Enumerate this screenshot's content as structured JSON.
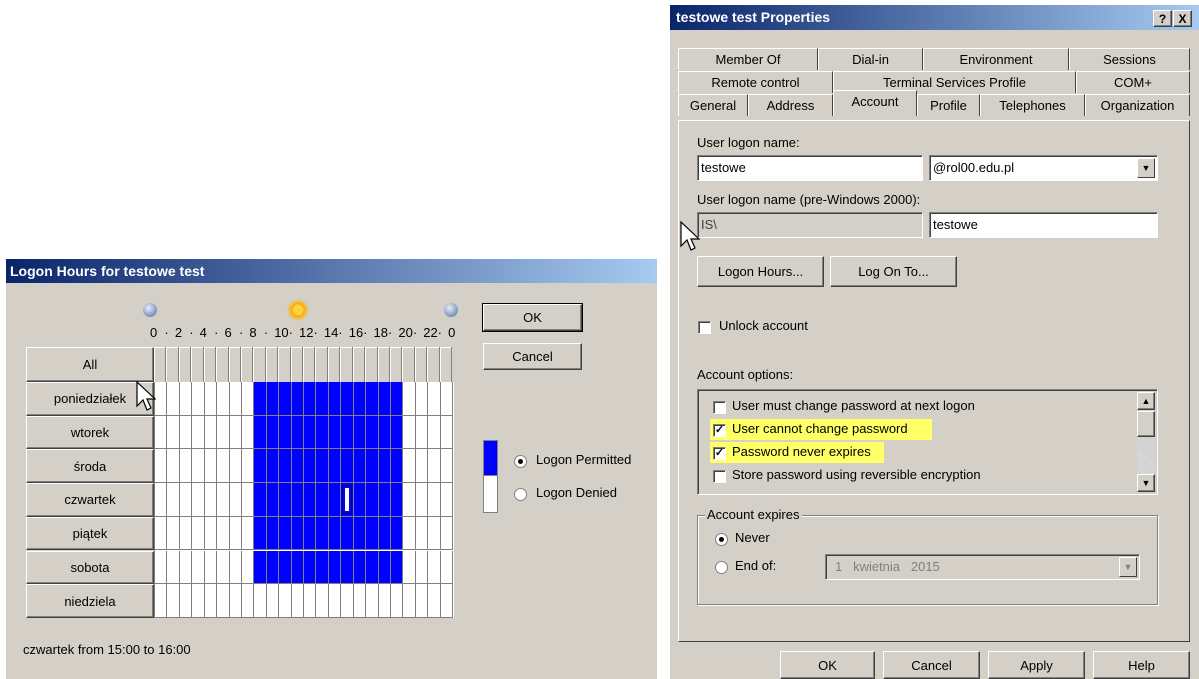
{
  "logon_hours": {
    "title": "Logon Hours for testowe test",
    "hour_labels": [
      "0",
      "2",
      "4",
      "6",
      "8",
      "10",
      "12",
      "14",
      "16",
      "18",
      "20",
      "22",
      "0"
    ],
    "ok_label": "OK",
    "cancel_label": "Cancel",
    "all_label": "All",
    "days": [
      "poniedziałek",
      "wtorek",
      "środa",
      "czwartek",
      "piątek",
      "sobota",
      "niedziela"
    ],
    "permitted_start_hour": 8,
    "permitted_end_hour": 20,
    "permitted_days": [
      "poniedziałek",
      "wtorek",
      "środa",
      "czwartek",
      "piątek",
      "sobota"
    ],
    "selected": {
      "day": "czwartek",
      "from": "15:00",
      "to": "16:00"
    },
    "legend_permitted": "Logon Permitted",
    "legend_denied": "Logon Denied",
    "legend_selected": "Logon Permitted",
    "status_text": "czwartek from 15:00 to 16:00",
    "colors": {
      "permitted": "#0000ff",
      "denied": "#ffffff"
    }
  },
  "properties": {
    "title": "testowe test Properties",
    "title_buttons": {
      "help": "?",
      "close": "X"
    },
    "tabs_row1": [
      "Member Of",
      "Dial-in",
      "Environment",
      "Sessions"
    ],
    "tabs_row2": [
      "Remote control",
      "Terminal Services Profile",
      "COM+"
    ],
    "tabs_row3": [
      "General",
      "Address",
      "Account",
      "Profile",
      "Telephones",
      "Organization"
    ],
    "active_tab": "Account",
    "user_logon_name_label": "User logon name:",
    "user_logon_name_value": "testowe",
    "domain_value": "@rol00.edu.pl",
    "pre2000_label": "User logon name (pre-Windows 2000):",
    "pre2000_domain": "IS\\",
    "pre2000_user": "testowe",
    "logon_hours_button": "Logon Hours...",
    "log_on_to_button": "Log On To...",
    "unlock_account_label": "Unlock account",
    "account_options_label": "Account options:",
    "account_options": [
      {
        "label": "User must change password at next logon",
        "checked": false,
        "highlighted": false
      },
      {
        "label": "User cannot change password",
        "checked": true,
        "highlighted": true
      },
      {
        "label": "Password never expires",
        "checked": true,
        "highlighted": true
      },
      {
        "label": "Store password using reversible encryption",
        "checked": false,
        "highlighted": false
      }
    ],
    "account_expires_label": "Account expires",
    "never_label": "Never",
    "end_of_label": "End of:",
    "end_of_value": "1   kwietnia   2015",
    "footer_buttons": {
      "ok": "OK",
      "cancel": "Cancel",
      "apply": "Apply",
      "help": "Help"
    },
    "highlight_color": "#ffff66"
  }
}
